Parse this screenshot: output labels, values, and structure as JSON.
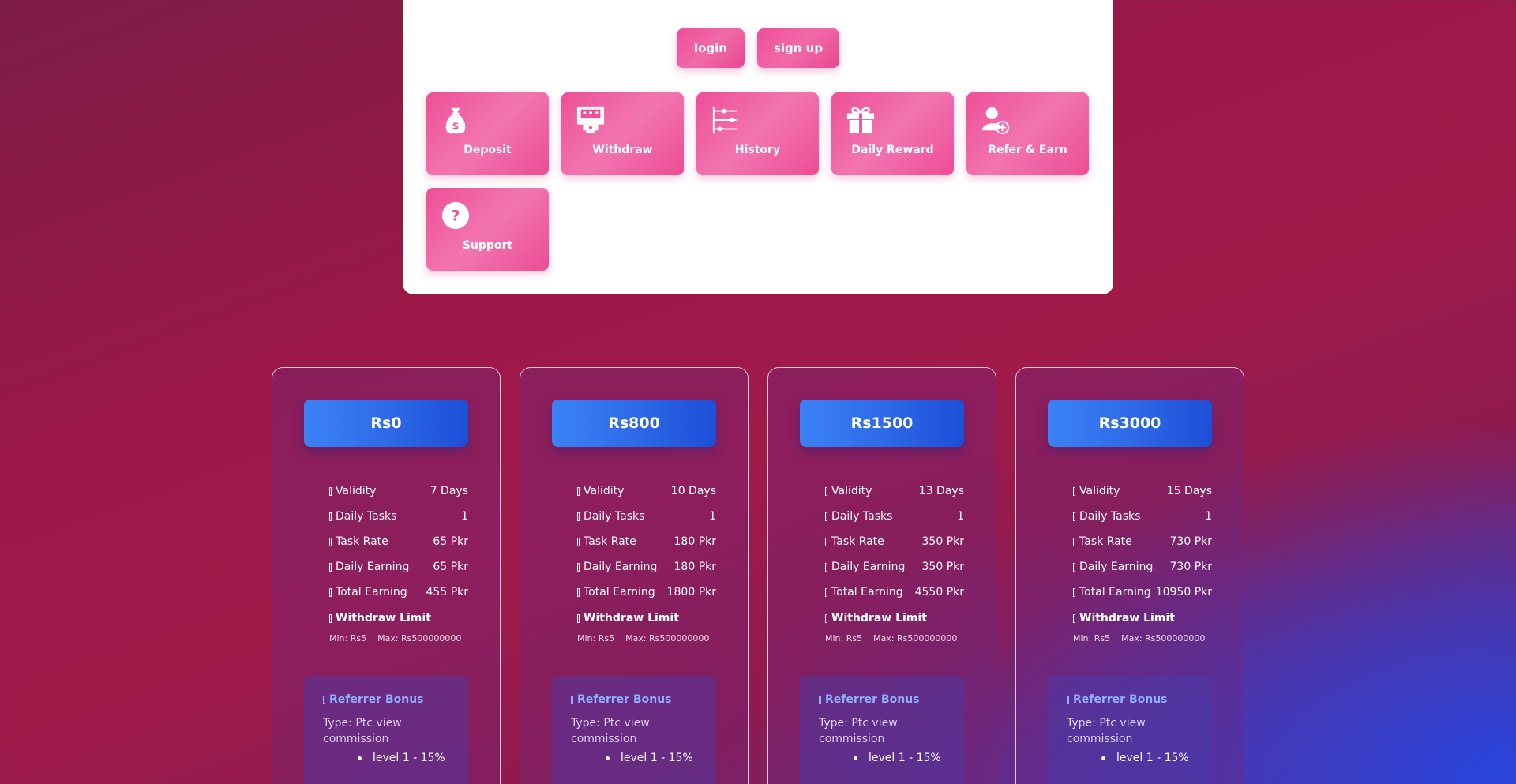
{
  "auth": {
    "login_label": "login",
    "signup_label": "sign up"
  },
  "tiles": [
    {
      "label": "Deposit",
      "icon": "money-bag-icon"
    },
    {
      "label": "Withdraw",
      "icon": "atm-icon"
    },
    {
      "label": "History",
      "icon": "history-sliders-icon"
    },
    {
      "label": "Daily Reward",
      "icon": "gift-icon"
    },
    {
      "label": "Refer & Earn",
      "icon": "add-user-icon"
    },
    {
      "label": "Support",
      "icon": "question-icon"
    }
  ],
  "row_labels": {
    "validity": "Validity",
    "daily_tasks": "Daily Tasks",
    "task_rate": "Task Rate",
    "daily_earning": "Daily Earning",
    "total_earning": "Total Earning",
    "withdraw_limit": "Withdraw Limit",
    "referrer_bonus": "Referrer Bonus"
  },
  "plans": [
    {
      "price": "Rs0",
      "validity": "7 Days",
      "daily_tasks": "1",
      "task_rate": "65 Pkr",
      "daily_earning": "65 Pkr",
      "total_earning": "455 Pkr",
      "min": "Min: Rs5",
      "max": "Max: Rs500000000",
      "ref_type": "Type: Ptc view commission",
      "level": "level 1 - 15%"
    },
    {
      "price": "Rs800",
      "validity": "10 Days",
      "daily_tasks": "1",
      "task_rate": "180 Pkr",
      "daily_earning": "180 Pkr",
      "total_earning": "1800 Pkr",
      "min": "Min: Rs5",
      "max": "Max: Rs500000000",
      "ref_type": "Type: Ptc view commission",
      "level": "level 1 - 15%"
    },
    {
      "price": "Rs1500",
      "validity": "13 Days",
      "daily_tasks": "1",
      "task_rate": "350 Pkr",
      "daily_earning": "350 Pkr",
      "total_earning": "4550 Pkr",
      "min": "Min: Rs5",
      "max": "Max: Rs500000000",
      "ref_type": "Type: Ptc view commission",
      "level": "level 1 - 15%"
    },
    {
      "price": "Rs3000",
      "validity": "15 Days",
      "daily_tasks": "1",
      "task_rate": "730 Pkr",
      "daily_earning": "730 Pkr",
      "total_earning": "10950 Pkr",
      "min": "Min: Rs5",
      "max": "Max: Rs500000000",
      "ref_type": "Type: Ptc view commission",
      "level": "level 1 - 15%"
    }
  ],
  "colors": {
    "tile_pink": "#ee4f98",
    "price_blue": "#2f6ae8",
    "ref_title": "#8fb0ff"
  }
}
